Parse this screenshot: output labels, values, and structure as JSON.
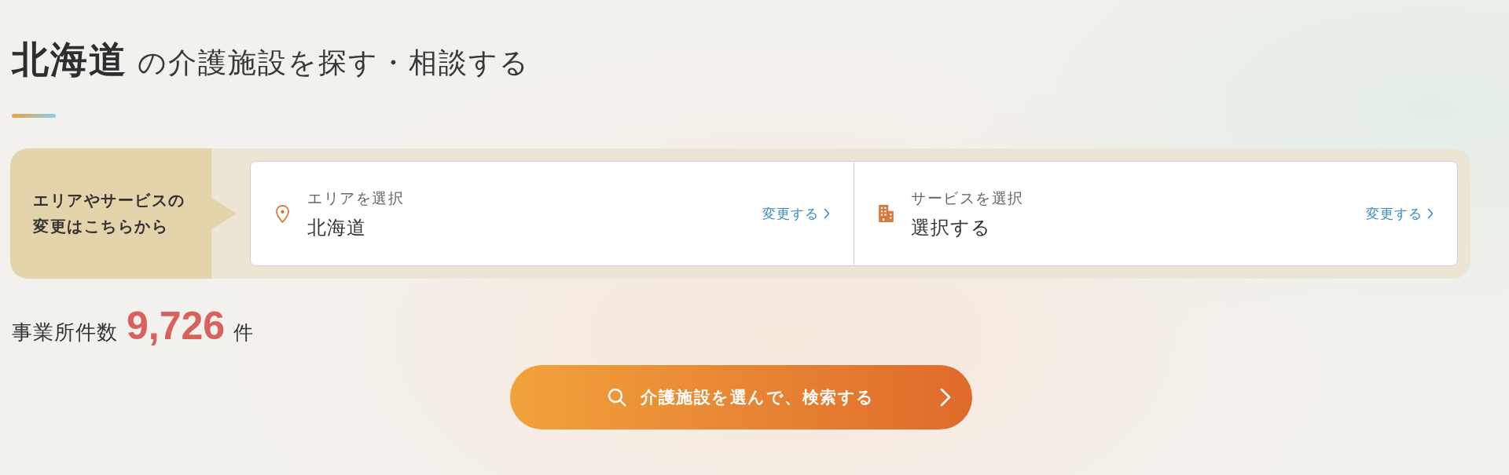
{
  "heading": {
    "title": "**北海道** の介護施設を探す・相談する"
  },
  "search_panel": {
    "prompt": "エリアやサービスの変更はこちらから",
    "fields": [
      {
        "kind": "area",
        "label": "エリアを選択",
        "value": "北海道",
        "link": "変更する"
      },
      {
        "kind": "service",
        "label": "サービスを選択",
        "value": "選択する",
        "link": "変更する"
      }
    ]
  },
  "result_count": {
    "label": "事業所件数",
    "value": "9,726",
    "unit": "件"
  },
  "search_button": {
    "label": "介護施設を選んで、検索する"
  }
}
